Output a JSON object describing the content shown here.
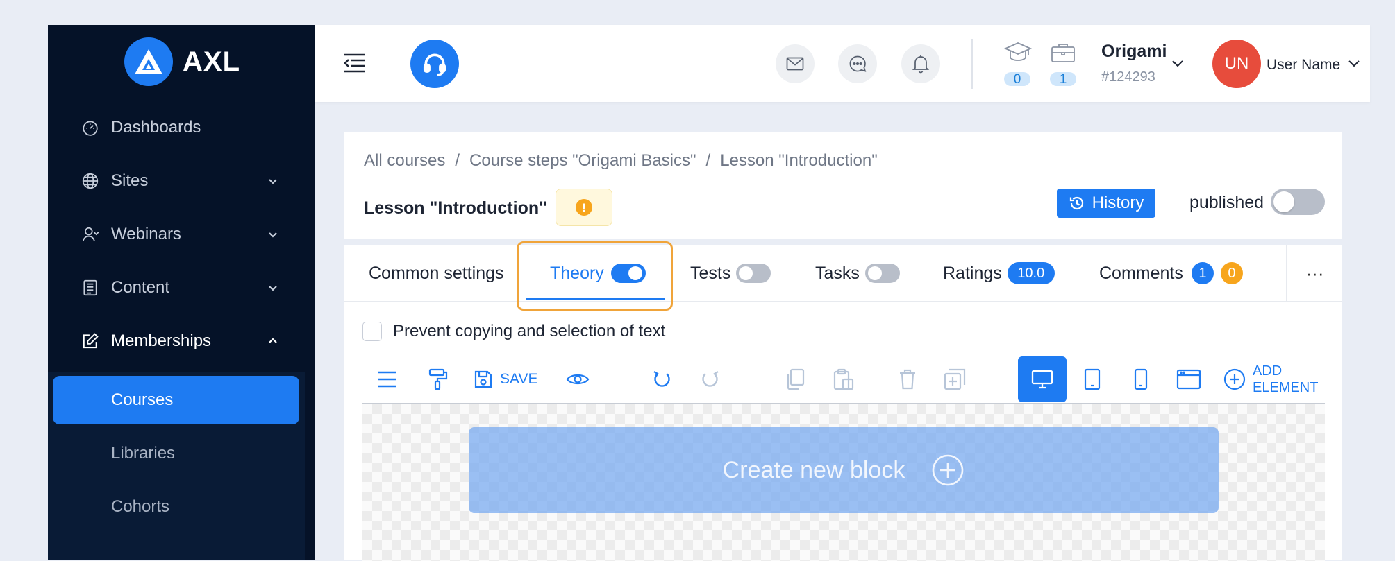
{
  "brand": {
    "name": "AXL",
    "accent": "#1e7bf2"
  },
  "sidebar": {
    "items": [
      {
        "label": "Dashboards",
        "icon": "gauge-icon"
      },
      {
        "label": "Sites",
        "icon": "globe-icon",
        "expandable": true
      },
      {
        "label": "Webinars",
        "icon": "person-icon",
        "expandable": true
      },
      {
        "label": "Content",
        "icon": "document-icon",
        "expandable": true
      },
      {
        "label": "Memberships",
        "icon": "edit-icon",
        "expanded": true
      }
    ],
    "submenu": [
      {
        "label": "Courses",
        "selected": true
      },
      {
        "label": "Libraries"
      },
      {
        "label": "Cohorts"
      }
    ]
  },
  "header": {
    "courses_count": "0",
    "projects_count": "1",
    "org_name": "Origami",
    "org_id": "#124293",
    "avatar_initials": "UN",
    "user_name": "User Name"
  },
  "breadcrumb": [
    "All courses",
    "Course steps \"Origami Basics\"",
    "Lesson \"Introduction\""
  ],
  "lesson": {
    "title": "Lesson \"Introduction\"",
    "warning_symbol": "!",
    "history_label": "History",
    "published_label": "published",
    "published": false
  },
  "tabs": {
    "common_settings": "Common settings",
    "theory": "Theory",
    "theory_enabled": true,
    "tests": "Tests",
    "tests_enabled": false,
    "tasks": "Tasks",
    "tasks_enabled": false,
    "ratings": "Ratings",
    "ratings_value": "10.0",
    "comments": "Comments",
    "comments_count_blue": "1",
    "comments_count_orange": "0",
    "more": "···"
  },
  "editor": {
    "prevent_copy_label": "Prevent copying and selection of text",
    "save_label": "SAVE",
    "add_element_line1": "ADD",
    "add_element_line2": "ELEMENT",
    "create_block_label": "Create new block"
  }
}
